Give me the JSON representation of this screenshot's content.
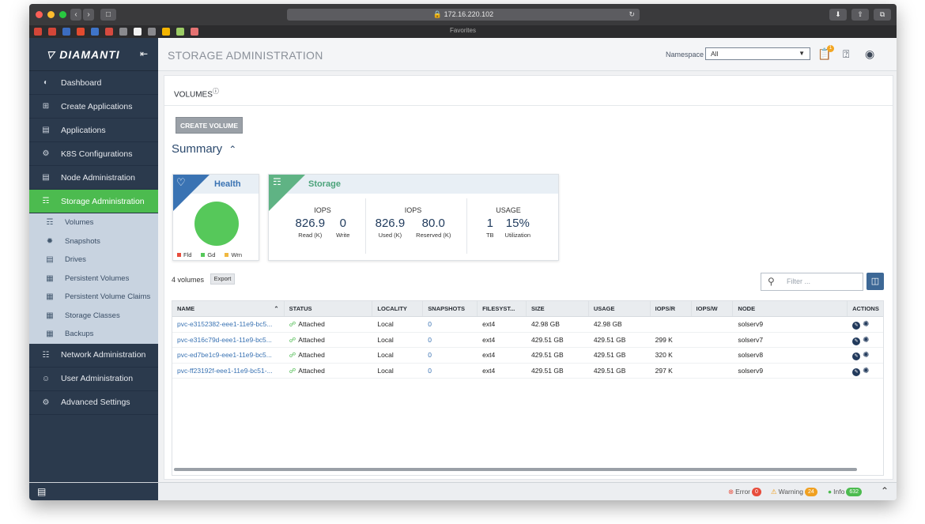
{
  "browser": {
    "url": "172.16.220.102",
    "favorites_label": "Favorites"
  },
  "sidebar": {
    "brand": "DIAMANTI",
    "items": [
      {
        "label": "Dashboard",
        "icon": "gauge-icon"
      },
      {
        "label": "Create Applications",
        "icon": "plus-square-icon"
      },
      {
        "label": "Applications",
        "icon": "list-icon"
      },
      {
        "label": "K8S Configurations",
        "icon": "cog-icon"
      },
      {
        "label": "Node Administration",
        "icon": "server-icon"
      },
      {
        "label": "Storage Administration",
        "icon": "database-icon"
      }
    ],
    "storage_sub": [
      {
        "label": "Volumes",
        "icon": "volume-icon"
      },
      {
        "label": "Snapshots",
        "icon": "snapshot-icon"
      },
      {
        "label": "Drives",
        "icon": "drive-icon"
      },
      {
        "label": "Persistent Volumes",
        "icon": "pv-icon"
      },
      {
        "label": "Persistent Volume Claims",
        "icon": "pvc-icon"
      },
      {
        "label": "Storage Classes",
        "icon": "storage-class-icon"
      },
      {
        "label": "Backups",
        "icon": "backup-icon"
      }
    ],
    "items_after": [
      {
        "label": "Network Administration",
        "icon": "network-icon"
      },
      {
        "label": "User Administration",
        "icon": "users-icon"
      },
      {
        "label": "Advanced Settings",
        "icon": "settings-icon"
      }
    ]
  },
  "header": {
    "title": "STORAGE ADMINISTRATION",
    "namespace_label": "Namespace",
    "namespace_value": "All",
    "notif_count": "1"
  },
  "main": {
    "section_title": "VOLUMES",
    "create_button": "CREATE VOLUME",
    "summary_title": "Summary",
    "health": {
      "title": "Health",
      "legend": [
        "Fld",
        "Gd",
        "Wrn"
      ],
      "colors": {
        "failed": "#e74c3c",
        "good": "#56c85a",
        "warn": "#f0b840"
      }
    },
    "storage": {
      "title": "Storage",
      "iops1": {
        "title": "IOPS",
        "v1": "826.9",
        "v2": "0",
        "l1": "Read (K)",
        "l2": "Write"
      },
      "iops2": {
        "title": "IOPS",
        "v1": "826.9",
        "v2": "80.0",
        "l1": "Used (K)",
        "l2": "Reserved (K)"
      },
      "usage": {
        "title": "USAGE",
        "v1": "1",
        "v2": "15%",
        "l1": "TB",
        "l2": "Utilization"
      }
    },
    "volume_count": "4 volumes",
    "export_label": "Export",
    "filter_placeholder": "Filter ...",
    "table": {
      "columns": [
        "NAME",
        "STATUS",
        "LOCALITY",
        "SNAPSHOTS",
        "FILESYST...",
        "SIZE",
        "USAGE",
        "IOPS/R",
        "IOPS/W",
        "NODE",
        "ACTIONS"
      ],
      "rows": [
        {
          "name": "pvc-e3152382-eee1-11e9-bc5...",
          "status": "Attached",
          "locality": "Local",
          "snapshots": "0",
          "fs": "ext4",
          "size": "42.98 GB",
          "usage": "42.98 GB",
          "iopsr": "",
          "iopsw": "",
          "node": "solserv9"
        },
        {
          "name": "pvc-e316c79d-eee1-11e9-bc5...",
          "status": "Attached",
          "locality": "Local",
          "snapshots": "0",
          "fs": "ext4",
          "size": "429.51 GB",
          "usage": "429.51 GB",
          "iopsr": "299 K",
          "iopsw": "",
          "node": "solserv7"
        },
        {
          "name": "pvc-ed7be1c9-eee1-11e9-bc5...",
          "status": "Attached",
          "locality": "Local",
          "snapshots": "0",
          "fs": "ext4",
          "size": "429.51 GB",
          "usage": "429.51 GB",
          "iopsr": "320 K",
          "iopsw": "",
          "node": "solserv8"
        },
        {
          "name": "pvc-ff23192f-eee1-11e9-bc51-...",
          "status": "Attached",
          "locality": "Local",
          "snapshots": "0",
          "fs": "ext4",
          "size": "429.51 GB",
          "usage": "429.51 GB",
          "iopsr": "297 K",
          "iopsw": "",
          "node": "solserv9"
        }
      ]
    }
  },
  "footer": {
    "error_label": "Error",
    "error_count": "0",
    "warning_label": "Warning",
    "warning_count": "24",
    "info_label": "Info",
    "info_count": "632"
  }
}
